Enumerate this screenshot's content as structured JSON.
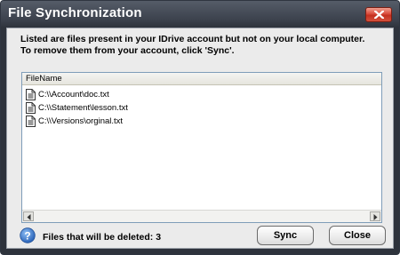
{
  "window": {
    "title": "File Synchronization",
    "close_icon": "close-x-icon"
  },
  "message": {
    "line1": "Listed are files present in your IDrive account but not on your local  computer.",
    "line2": "To remove them from your account, click 'Sync'."
  },
  "file_list": {
    "column_header": "FileName",
    "item_icon": "document-icon",
    "files": [
      "C:\\\\Account\\doc.txt",
      "C:\\\\Statement\\lesson.txt",
      "C:\\\\Versions\\orginal.txt"
    ]
  },
  "status": {
    "icon": "help-info-icon",
    "text": "Files that will be deleted: 3"
  },
  "buttons": {
    "sync_label": "Sync",
    "close_label": "Close"
  },
  "colors": {
    "titlebar": "#3b414c",
    "close_button": "#d9493a",
    "info_icon": "#2a63b8"
  }
}
